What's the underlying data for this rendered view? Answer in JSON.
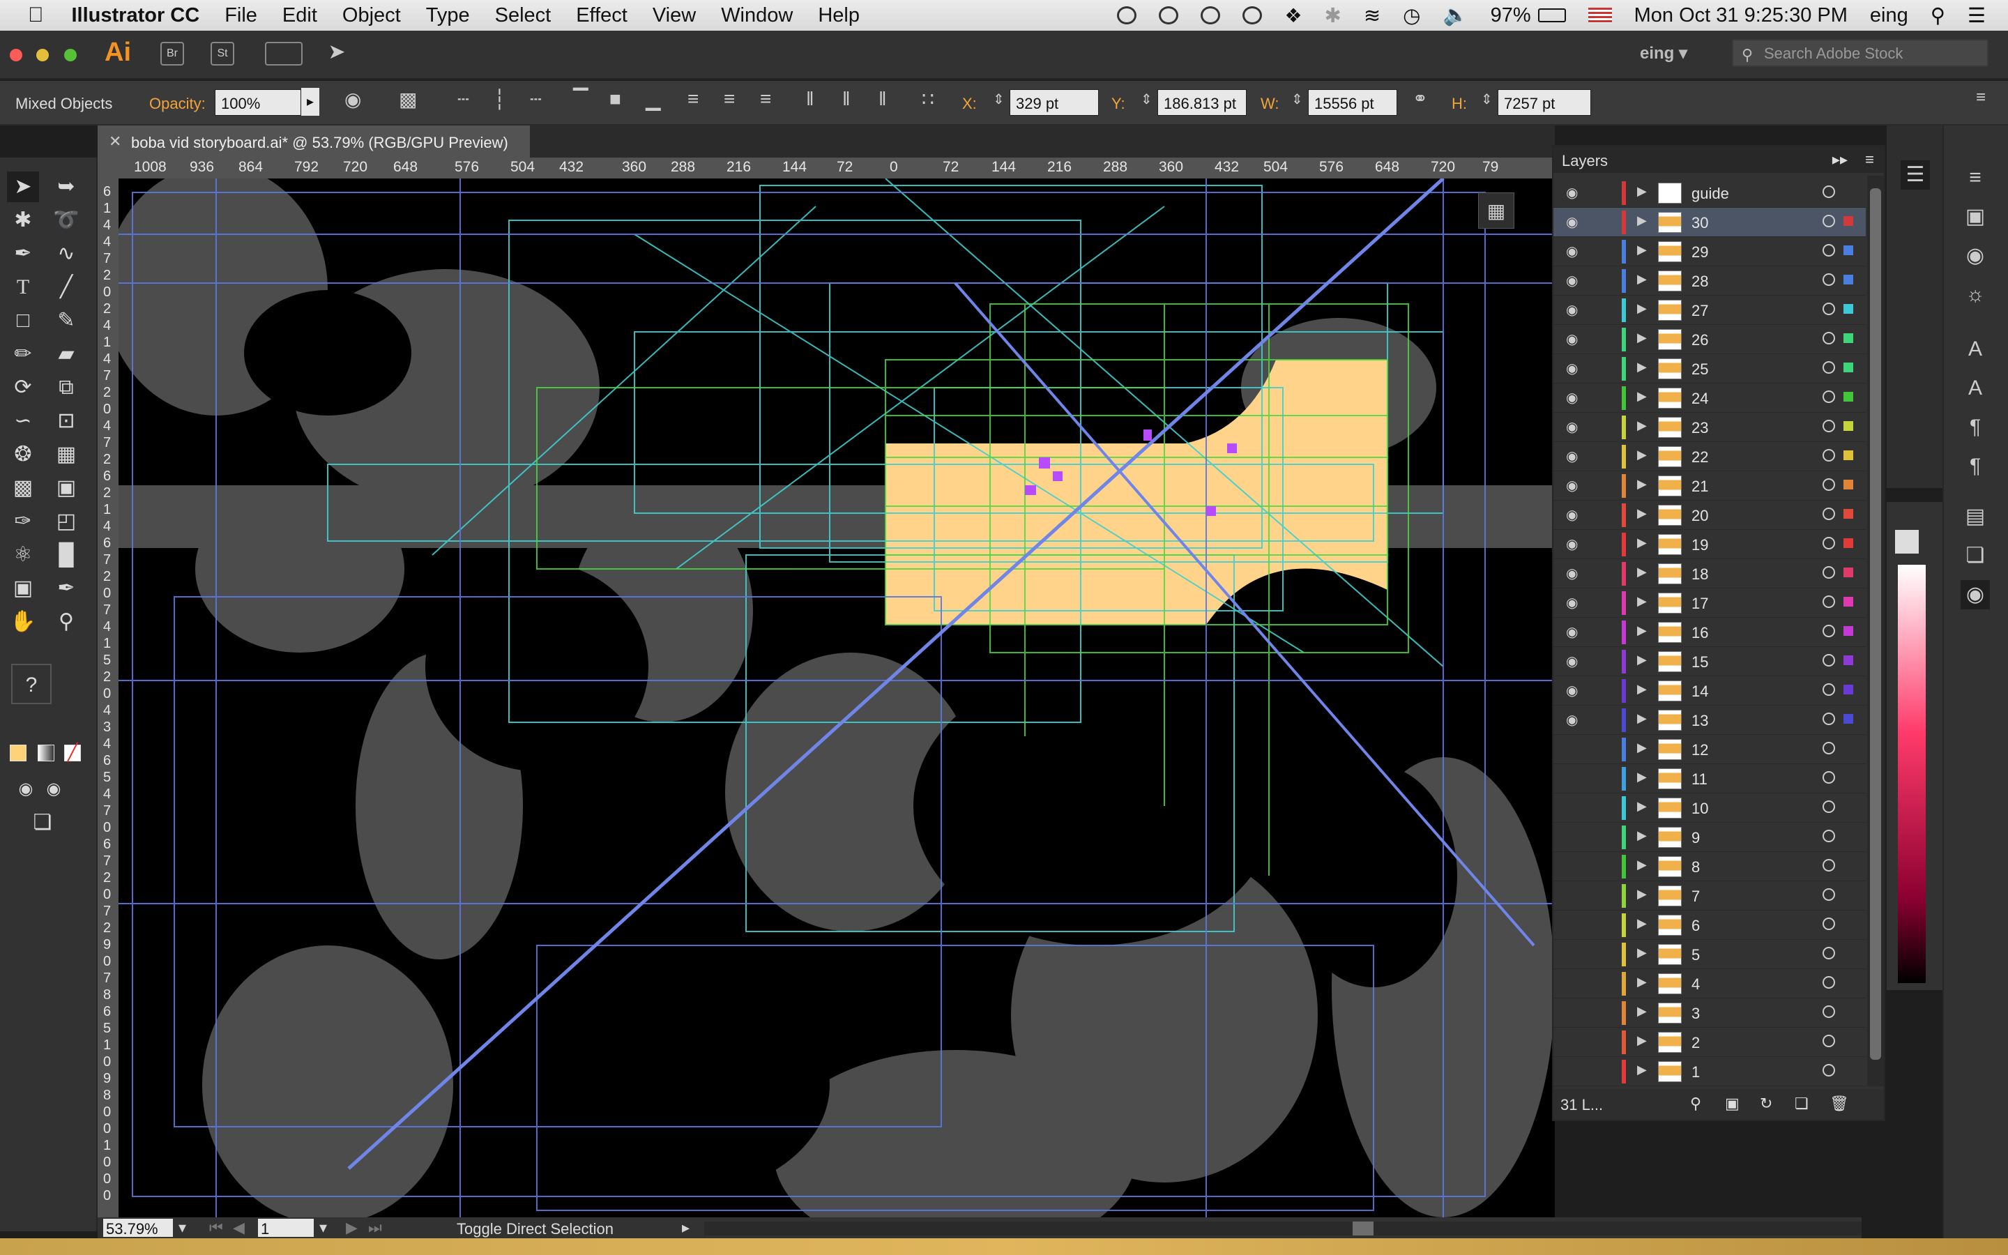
{
  "menubar": {
    "app": "Illustrator CC",
    "items": [
      "File",
      "Edit",
      "Object",
      "Type",
      "Select",
      "Effect",
      "View",
      "Window",
      "Help"
    ],
    "battery": "97%",
    "datetime": "Mon Oct 31  9:25:30 PM",
    "user": "eing"
  },
  "appbar": {
    "logo": "Ai",
    "bridge": "Br",
    "stock": "St",
    "workspace": "eing",
    "search_placeholder": "Search Adobe Stock"
  },
  "control": {
    "selection": "Mixed Objects",
    "opacity_label": "Opacity:",
    "opacity": "100%",
    "x_label": "X:",
    "x": "329 pt",
    "y_label": "Y:",
    "y": "186.813 pt",
    "w_label": "W:",
    "w": "15556 pt",
    "h_label": "H:",
    "h": "7257 pt"
  },
  "document": {
    "tab": "boba vid storyboard.ai* @ 53.79% (RGB/GPU Preview)"
  },
  "ruler": {
    "ticks": [
      "1008",
      "936",
      "864",
      "792",
      "720",
      "648",
      "576",
      "504",
      "432",
      "360",
      "288",
      "216",
      "144",
      "72",
      "0",
      "72",
      "144",
      "216",
      "288",
      "360",
      "432",
      "504",
      "576",
      "648",
      "720",
      "79"
    ]
  },
  "status": {
    "zoom": "53.79%",
    "artboard": "1",
    "mode": "Toggle Direct Selection"
  },
  "layers": {
    "title": "Layers",
    "count": "31 L...",
    "items": [
      {
        "name": "guide",
        "color": "#d13a3a"
      },
      {
        "name": "30",
        "color": "#d13a3a"
      },
      {
        "name": "29",
        "color": "#4a7fe0"
      },
      {
        "name": "28",
        "color": "#4a7fe0"
      },
      {
        "name": "27",
        "color": "#3ec9d4"
      },
      {
        "name": "26",
        "color": "#3ed47a"
      },
      {
        "name": "25",
        "color": "#3ed47a"
      },
      {
        "name": "24",
        "color": "#44c43a"
      },
      {
        "name": "23",
        "color": "#c4d43a"
      },
      {
        "name": "22",
        "color": "#e0c23a"
      },
      {
        "name": "21",
        "color": "#e0843a"
      },
      {
        "name": "20",
        "color": "#e04a3a"
      },
      {
        "name": "19",
        "color": "#e03a3a"
      },
      {
        "name": "18",
        "color": "#e03a6a"
      },
      {
        "name": "17",
        "color": "#e03ab0"
      },
      {
        "name": "16",
        "color": "#c43ad4"
      },
      {
        "name": "15",
        "color": "#8e3ad4"
      },
      {
        "name": "14",
        "color": "#6a3ad4"
      },
      {
        "name": "13",
        "color": "#4a4ad4"
      },
      {
        "name": "12",
        "color": "#4a7fe0"
      },
      {
        "name": "11",
        "color": "#3ea0e0"
      },
      {
        "name": "10",
        "color": "#3ec9d4"
      },
      {
        "name": "9",
        "color": "#3ed47a"
      },
      {
        "name": "8",
        "color": "#44c43a"
      },
      {
        "name": "7",
        "color": "#8ed43a"
      },
      {
        "name": "6",
        "color": "#c4d43a"
      },
      {
        "name": "5",
        "color": "#e0c23a"
      },
      {
        "name": "4",
        "color": "#e0a83a"
      },
      {
        "name": "3",
        "color": "#e0843a"
      },
      {
        "name": "2",
        "color": "#e05a3a"
      },
      {
        "name": "1",
        "color": "#e03a3a"
      }
    ]
  }
}
